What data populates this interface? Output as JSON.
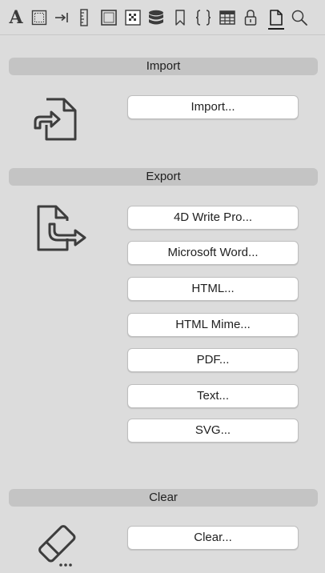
{
  "toolbar": {
    "items": [
      {
        "icon": "text-format-icon",
        "glyph": "A"
      },
      {
        "icon": "border-frame-icon"
      },
      {
        "icon": "tab-stop-icon"
      },
      {
        "icon": "ruler-icon"
      },
      {
        "icon": "box-icon"
      },
      {
        "icon": "background-pattern-icon"
      },
      {
        "icon": "database-icon"
      },
      {
        "icon": "bookmark-icon"
      },
      {
        "icon": "braces-icon"
      },
      {
        "icon": "table-icon"
      },
      {
        "icon": "lock-icon"
      },
      {
        "icon": "document-icon",
        "selected": true
      },
      {
        "icon": "search-icon"
      }
    ]
  },
  "import_section": {
    "title": "Import",
    "icon": "document-import-icon",
    "buttons": [
      "Import..."
    ]
  },
  "export_section": {
    "title": "Export",
    "icon": "document-export-icon",
    "buttons": [
      "4D Write Pro...",
      "Microsoft Word...",
      "HTML...",
      "HTML Mime...",
      "PDF...",
      "Text...",
      "SVG..."
    ]
  },
  "clear_section": {
    "title": "Clear",
    "icon": "eraser-icon",
    "buttons": [
      "Clear..."
    ]
  },
  "colors": {
    "background": "#dcdcdc",
    "section_header": "#c4c4c4",
    "button_bg": "#ffffff",
    "icon_stroke": "#3d3d3d"
  }
}
